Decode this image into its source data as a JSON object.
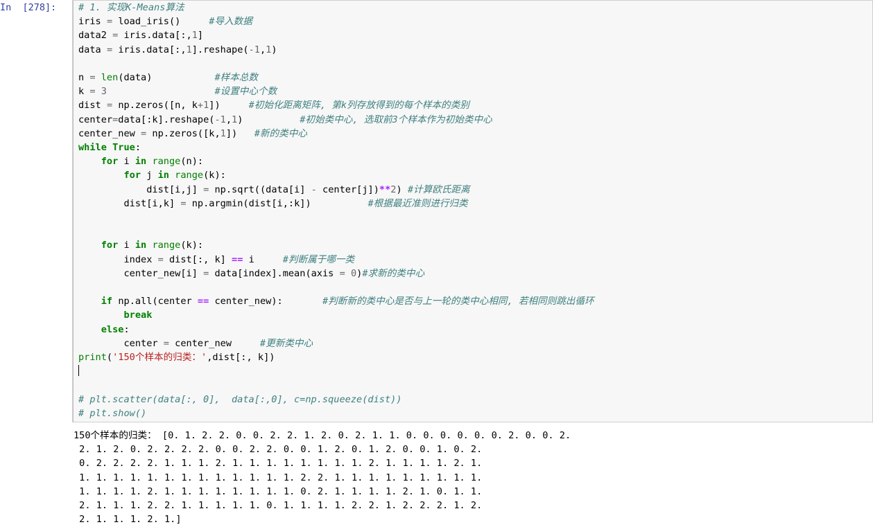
{
  "cell": {
    "prompt_label": "In  [278]:",
    "execution_count": "278",
    "code_lines": [
      {
        "id": "l1",
        "text": "# 1. 实现K-Means算法"
      },
      {
        "id": "l2",
        "text": "iris = load_iris()     #导入数据"
      },
      {
        "id": "l3",
        "text": "data2 = iris.data[:,1]"
      },
      {
        "id": "l4",
        "text": "data = iris.data[:,1].reshape(-1,1)"
      },
      {
        "id": "l5",
        "text": ""
      },
      {
        "id": "l6",
        "text": "n = len(data)           #样本总数"
      },
      {
        "id": "l7",
        "text": "k = 3                   #设置中心个数"
      },
      {
        "id": "l8",
        "text": "dist = np.zeros([n, k+1])     #初始化距离矩阵, 第k列存放得到的每个样本的类别"
      },
      {
        "id": "l9",
        "text": "center=data[:k].reshape(-1,1)          #初始类中心, 选取前3个样本作为初始类中心"
      },
      {
        "id": "l10",
        "text": "center_new = np.zeros([k,1])   #新的类中心"
      },
      {
        "id": "l11",
        "text": "while True:"
      },
      {
        "id": "l12",
        "text": "    for i in range(n):"
      },
      {
        "id": "l13",
        "text": "        for j in range(k):"
      },
      {
        "id": "l14",
        "text": "            dist[i,j] = np.sqrt((data[i] - center[j])**2) #计算欧氏距离"
      },
      {
        "id": "l15",
        "text": "        dist[i,k] = np.argmin(dist[i,:k])          #根据最近准则进行归类"
      },
      {
        "id": "l16",
        "text": ""
      },
      {
        "id": "l17",
        "text": ""
      },
      {
        "id": "l18",
        "text": "    for i in range(k):"
      },
      {
        "id": "l19",
        "text": "        index = dist[:, k] == i     #判断属于哪一类"
      },
      {
        "id": "l20",
        "text": "        center_new[i] = data[index].mean(axis = 0)#求新的类中心"
      },
      {
        "id": "l21",
        "text": ""
      },
      {
        "id": "l22",
        "text": "    if np.all(center == center_new):       #判断新的类中心是否与上一轮的类中心相同, 若相同则跳出循环"
      },
      {
        "id": "l23",
        "text": "        break"
      },
      {
        "id": "l24",
        "text": "    else:"
      },
      {
        "id": "l25",
        "text": "        center = center_new     #更新类中心"
      },
      {
        "id": "l26",
        "text": "print('150个样本的归类：',dist[:, k])"
      },
      {
        "id": "l27",
        "text": ""
      },
      {
        "id": "l28",
        "text": "# plt.scatter(data[:, 0],  data[:,0], c=np.squeeze(dist))"
      },
      {
        "id": "l29",
        "text": "# plt.show()"
      }
    ],
    "output_label": "150个样本的归类：",
    "output_lines": [
      "150个样本的归类： [0. 1. 2. 2. 0. 0. 2. 2. 1. 2. 0. 2. 1. 1. 0. 0. 0. 0. 0. 0. 2. 0. 0. 2.",
      " 2. 1. 2. 0. 2. 2. 2. 2. 0. 0. 2. 2. 0. 0. 1. 2. 0. 1. 2. 0. 0. 1. 0. 2.",
      " 0. 2. 2. 2. 2. 1. 1. 1. 2. 1. 1. 1. 1. 1. 1. 1. 1. 2. 1. 1. 1. 1. 2. 1.",
      " 1. 1. 1. 1. 1. 1. 1. 1. 1. 1. 1. 1. 1. 2. 2. 1. 1. 1. 1. 1. 1. 1. 1. 1.",
      " 1. 1. 1. 1. 2. 1. 1. 1. 1. 1. 1. 1. 1. 0. 2. 1. 1. 1. 1. 2. 1. 0. 1. 1.",
      " 2. 1. 1. 1. 2. 2. 1. 1. 1. 1. 1. 0. 1. 1. 1. 1. 2. 2. 1. 2. 2. 2. 1. 2.",
      " 2. 1. 1. 1. 2. 1.]"
    ]
  },
  "colors": {
    "comment": "#408080",
    "keyword": "#008000",
    "string": "#BA2121",
    "number": "#666666",
    "operator_power": "#AA22FF",
    "prompt": "#303F9F",
    "cell_background": "#f7f7f7",
    "cell_border": "#cfcfcf",
    "page_background": "#ffffff"
  }
}
